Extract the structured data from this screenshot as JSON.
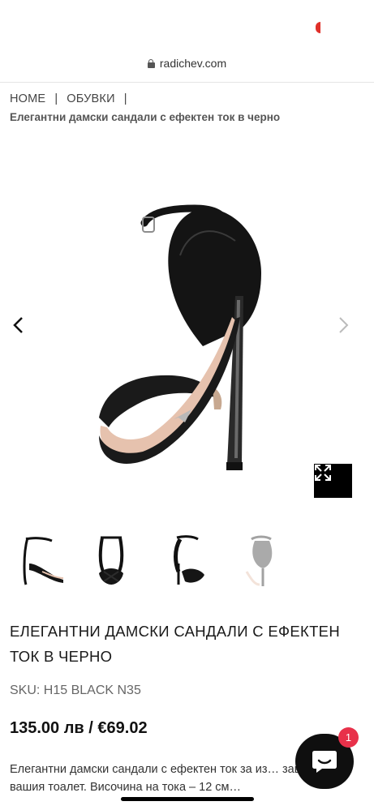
{
  "browser": {
    "domain": "radichev.com"
  },
  "breadcrumb": {
    "items": [
      "HOME",
      "ОБУВКИ"
    ],
    "separator": "|",
    "current": "Елегантни дамски сандали с ефектен ток в черно"
  },
  "gallery": {
    "prev_icon": "chevron-left-icon",
    "next_icon": "chevron-right-icon",
    "zoom_icon": "expand-icon"
  },
  "product": {
    "title": "ЕЛЕГАНТНИ ДАМСКИ САНДАЛИ С ЕФЕКТЕН ТОК В ЧЕРНО",
    "sku": "SKU: H15 BLACK N35",
    "price": "135.00 лв / €69.02",
    "description": "Елегантни дамски сандали с ефектен ток за из… завършек на вашия тоалет. Височина на тока – 12 см…"
  },
  "chat": {
    "badge_count": "1"
  },
  "colors": {
    "accent": "#e8314a",
    "status_dot": "#e0302a",
    "leather": "#141414",
    "sole": "#e6c2ae"
  }
}
